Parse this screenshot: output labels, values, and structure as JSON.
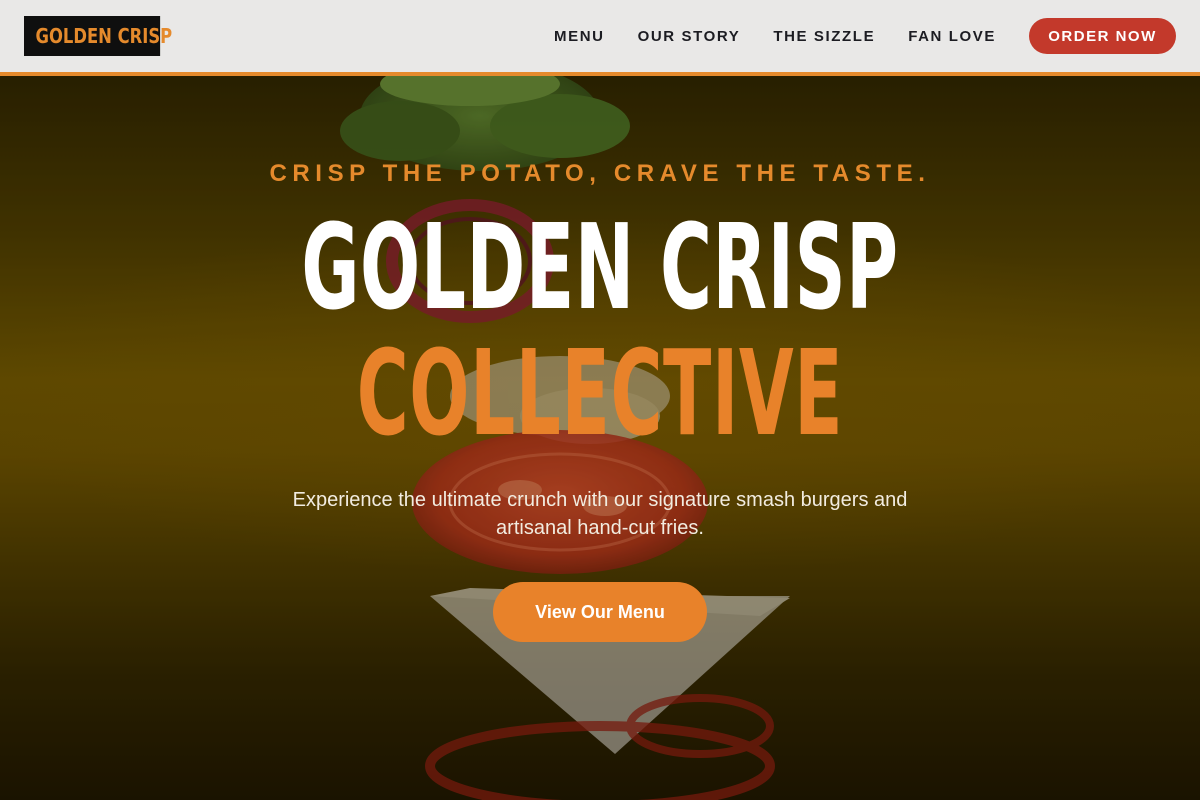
{
  "nav": {
    "logo": "GOLDEN CRISP",
    "links": [
      "MENU",
      "OUR STORY",
      "THE SIZZLE",
      "FAN LOVE"
    ],
    "order_button": "ORDER NOW"
  },
  "hero": {
    "tagline": "CRISP THE POTATO, CRAVE THE TASTE.",
    "title_line1": "GOLDEN CRISP",
    "title_line2": "COLLECTIVE",
    "subtitle": "Experience the ultimate crunch with our signature smash burgers and artisanal hand-cut fries.",
    "cta_label": "View Our Menu",
    "background_image": "floating-burger-ingredients"
  },
  "colors": {
    "accent_orange": "#e58a2c",
    "order_red": "#c3392b",
    "nav_background": "#e9e8e7",
    "hero_background": "#4a3a00"
  }
}
